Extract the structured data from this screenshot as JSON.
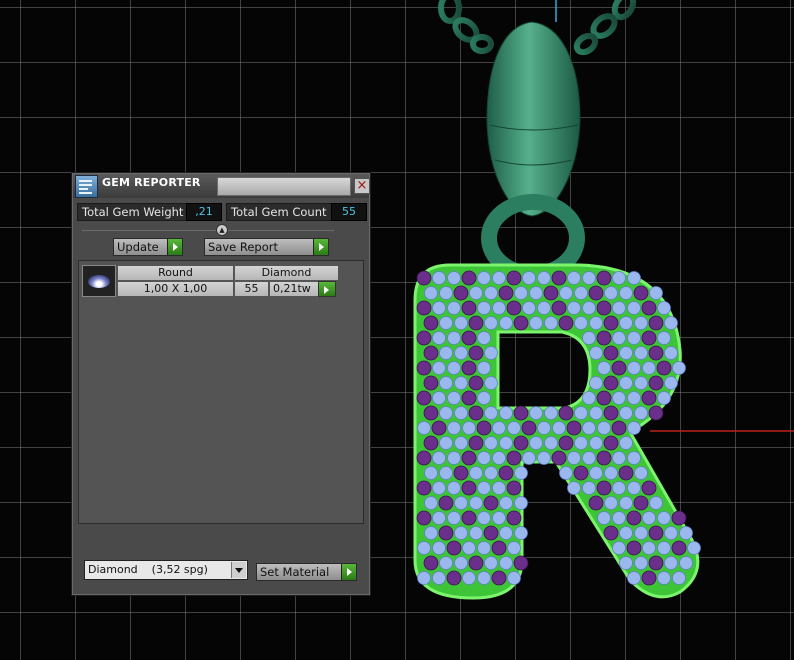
{
  "window": {
    "title": "GEM REPORTER",
    "icon": "gem-reporter-icon",
    "close_icon": "close-icon"
  },
  "summary": {
    "weight_label": "Total Gem Weight",
    "weight_value": ",21",
    "count_label": "Total Gem Count",
    "count_value": "55"
  },
  "actions": {
    "update_label": "Update",
    "save_report_label": "Save Report"
  },
  "gem_list": [
    {
      "shape": "Round",
      "material": "Diamond",
      "size": "1,00 X 1,00",
      "count": "55",
      "weight": "0,21tw"
    }
  ],
  "footer": {
    "material_selected": "Diamond    (3,52 spg)",
    "set_material_label": "Set Material"
  },
  "colors": {
    "value_text": "#4cc6e6",
    "action_green": "#3a9a20",
    "pendant_green": "#3bbf34",
    "bail_teal": "#2f8a6a",
    "gem_blue": "#9ab8ee",
    "gem_purple": "#6a2f8a"
  }
}
